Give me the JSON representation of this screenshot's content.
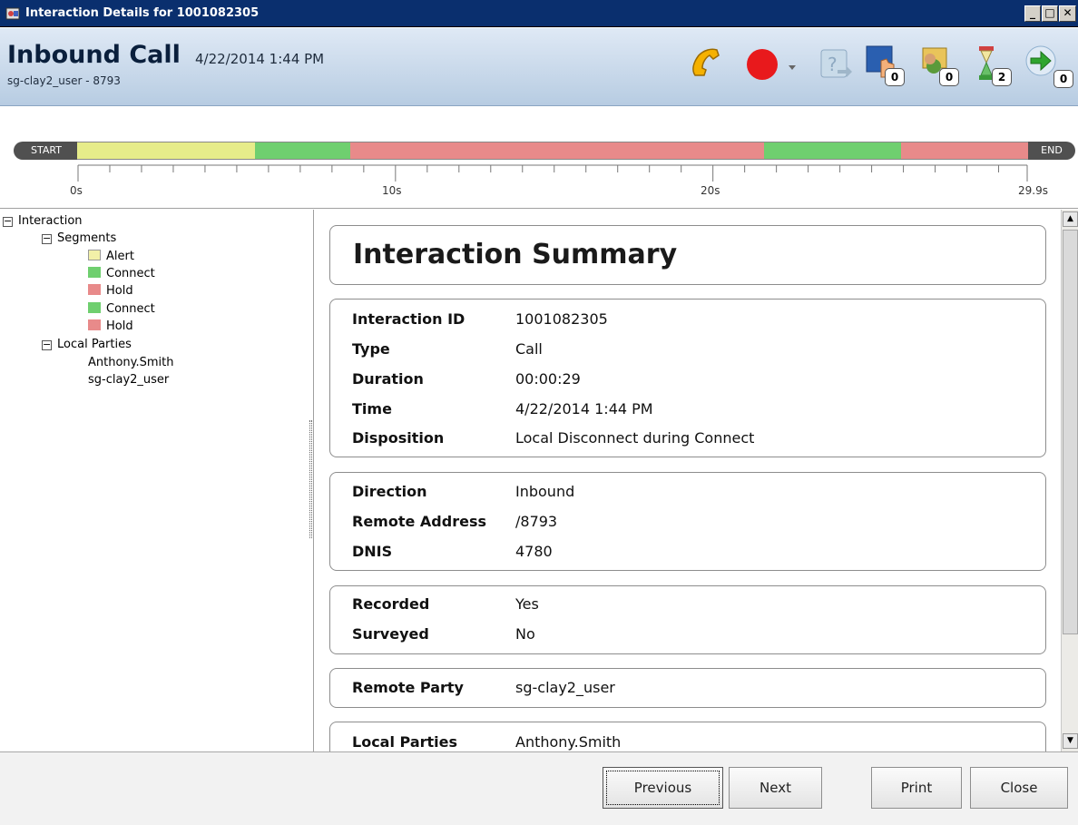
{
  "window": {
    "title": "Interaction Details for 1001082305",
    "controls": [
      "_",
      "□",
      "✕"
    ]
  },
  "header": {
    "call_type": "Inbound Call",
    "datetime": "4/22/2014 1:44 PM",
    "subtitle": "sg-clay2_user - 8793",
    "toolbar": [
      {
        "name": "phone-icon",
        "badge": null
      },
      {
        "name": "record-icon",
        "badge": null
      },
      {
        "name": "dropdown-icon",
        "badge": null
      },
      {
        "name": "transfer-icon",
        "badge": null
      },
      {
        "name": "screen-icon",
        "badge": "0"
      },
      {
        "name": "survey-icon",
        "badge": "0"
      },
      {
        "name": "hourglass-icon",
        "badge": "2"
      },
      {
        "name": "next-arrow-icon",
        "badge": "0"
      }
    ]
  },
  "timeline": {
    "start_label": "START",
    "end_label": "END",
    "total_seconds": 29.9,
    "segments": [
      {
        "type": "Alert",
        "color": "#e6ec8a",
        "from": 0,
        "to": 5.6
      },
      {
        "type": "Connect",
        "color": "#6fcf6f",
        "from": 5.6,
        "to": 8.6
      },
      {
        "type": "Hold",
        "color": "#e88a8a",
        "from": 8.6,
        "to": 21.6
      },
      {
        "type": "Connect",
        "color": "#6fcf6f",
        "from": 21.6,
        "to": 25.9
      },
      {
        "type": "Hold",
        "color": "#e88a8a",
        "from": 25.9,
        "to": 29.9
      }
    ],
    "axis_labels": [
      "0s",
      "10s",
      "20s",
      "29.9s"
    ]
  },
  "tree": {
    "root": "Interaction",
    "segments_label": "Segments",
    "segments": [
      {
        "label": "Alert",
        "color": "#e6ec8a"
      },
      {
        "label": "Connect",
        "color": "#6fcf6f"
      },
      {
        "label": "Hold",
        "color": "#e88a8a"
      },
      {
        "label": "Connect",
        "color": "#6fcf6f"
      },
      {
        "label": "Hold",
        "color": "#e88a8a"
      }
    ],
    "parties_label": "Local Parties",
    "parties": [
      "Anthony.Smith",
      "sg-clay2_user"
    ]
  },
  "summary": {
    "title": "Interaction Summary",
    "groups": [
      [
        {
          "key": "Interaction ID",
          "value": "1001082305"
        },
        {
          "key": "Type",
          "value": "Call"
        },
        {
          "key": "Duration",
          "value": "00:00:29"
        },
        {
          "key": "Time",
          "value": "4/22/2014 1:44 PM"
        },
        {
          "key": "Disposition",
          "value": "Local Disconnect during Connect"
        }
      ],
      [
        {
          "key": "Direction",
          "value": "Inbound"
        },
        {
          "key": "Remote Address",
          "value": "/8793"
        },
        {
          "key": "DNIS",
          "value": "4780"
        }
      ],
      [
        {
          "key": "Recorded",
          "value": "Yes"
        },
        {
          "key": "Surveyed",
          "value": "No"
        }
      ],
      [
        {
          "key": "Remote Party",
          "value": "sg-clay2_user"
        }
      ],
      [
        {
          "key": "Local Parties",
          "value": "Anthony.Smith"
        }
      ]
    ]
  },
  "buttons": {
    "previous": "Previous",
    "next": "Next",
    "print": "Print",
    "close": "Close"
  }
}
